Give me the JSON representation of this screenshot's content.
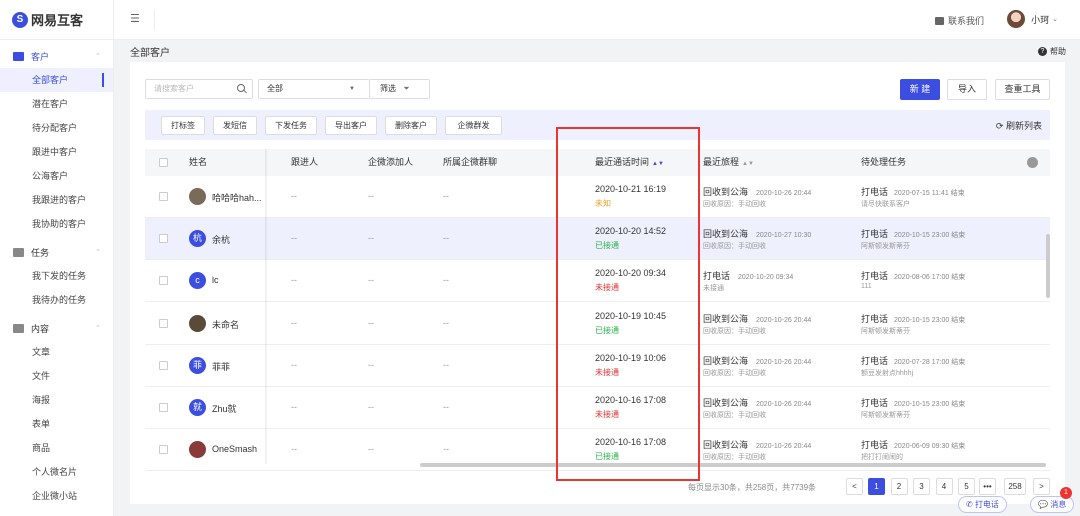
{
  "brand": {
    "name": "网易互客"
  },
  "colors": {
    "accent": "#3b4ee0",
    "red": "#e33333",
    "green": "#2bb34a",
    "orange": "#f0a020"
  },
  "sidebar": {
    "groups": [
      {
        "label": "客户",
        "icon": "contact-card-icon",
        "items": [
          "全部客户",
          "潜在客户",
          "待分配客户",
          "跟进中客户",
          "公海客户",
          "我跟进的客户",
          "我协助的客户"
        ]
      },
      {
        "label": "任务",
        "icon": "task-icon",
        "items": [
          "我下发的任务",
          "我待办的任务"
        ]
      },
      {
        "label": "内容",
        "icon": "content-icon",
        "items": [
          "文章",
          "文件",
          "海报",
          "表单",
          "商品",
          "个人微名片",
          "企业微小站"
        ]
      }
    ]
  },
  "topbar": {
    "contact": "联系我们",
    "user": "小珂"
  },
  "page": {
    "title": "全部客户",
    "help": "帮助"
  },
  "filters": {
    "search_placeholder": "请搜索客户",
    "select_value": "全部",
    "filter_label": "筛选",
    "new": "新 建",
    "import": "导入",
    "dedup": "查重工具"
  },
  "toolbar": {
    "buttons": [
      "打标签",
      "发短信",
      "下发任务",
      "导出客户",
      "删除客户",
      "企微群发"
    ],
    "refresh": "刷新列表"
  },
  "table": {
    "headers": [
      "姓名",
      "跟进人",
      "企微添加人",
      "所属企微群聊",
      "最近通话时间",
      "最近旅程",
      "待处理任务"
    ],
    "rows": [
      {
        "name": "哈哈哈hah...",
        "avatar_text": "",
        "avatar_color": "#7a6a5a",
        "follower": "--",
        "adder": "--",
        "group": "--",
        "call_time": "2020-10-21 16:19",
        "call_status": "未知",
        "status_color": "#f0a020",
        "journey": "回收到公海",
        "journey_time": "2020-10-26 20:44",
        "journey_sub": "回收原因：手动回收",
        "task": "打电话",
        "task_time": "2020-07-15 11:41 结束",
        "task_sub": "请尽快联系客户"
      },
      {
        "name": "余杭",
        "avatar_text": "杭",
        "avatar_color": "#3b4ee0",
        "follower": "--",
        "adder": "--",
        "group": "--",
        "call_time": "2020-10-20 14:52",
        "call_status": "已接通",
        "status_color": "#2bb34a",
        "journey": "回收到公海",
        "journey_time": "2020-10-27 10:30",
        "journey_sub": "回收原因：手动回收",
        "task": "打电话",
        "task_time": "2020-10-15 23:00 结束",
        "task_sub": "阿斯顿发斯蒂芬"
      },
      {
        "name": "lc",
        "avatar_text": "c",
        "avatar_color": "#3b4ee0",
        "follower": "--",
        "adder": "--",
        "group": "--",
        "call_time": "2020-10-20 09:34",
        "call_status": "未接通",
        "status_color": "#e33333",
        "journey": "打电话",
        "journey_time": "2020-10-20 09:34",
        "journey_sub": "未接通",
        "task": "打电话",
        "task_time": "2020-08-06 17:00 结束",
        "task_sub": "111"
      },
      {
        "name": "未命名",
        "avatar_text": "",
        "avatar_color": "#5a4a3a",
        "follower": "--",
        "adder": "--",
        "group": "--",
        "call_time": "2020-10-19 10:45",
        "call_status": "已接通",
        "status_color": "#2bb34a",
        "journey": "回收到公海",
        "journey_time": "2020-10-26 20:44",
        "journey_sub": "回收原因：手动回收",
        "task": "打电话",
        "task_time": "2020-10-15 23:00 结束",
        "task_sub": "阿斯顿发斯蒂芬"
      },
      {
        "name": "菲菲",
        "avatar_text": "菲",
        "avatar_color": "#3b4ee0",
        "follower": "--",
        "adder": "--",
        "group": "--",
        "call_time": "2020-10-19 10:06",
        "call_status": "未接通",
        "status_color": "#e33333",
        "journey": "回收到公海",
        "journey_time": "2020-10-26 20:44",
        "journey_sub": "回收原因：手动回收",
        "task": "打电话",
        "task_time": "2020-07-28 17:00 结束",
        "task_sub": "额豆发射点hhhhj"
      },
      {
        "name": "Zhu就",
        "avatar_text": "就",
        "avatar_color": "#3b4ee0",
        "follower": "--",
        "adder": "--",
        "group": "--",
        "call_time": "2020-10-16 17:08",
        "call_status": "未接通",
        "status_color": "#e33333",
        "journey": "回收到公海",
        "journey_time": "2020-10-26 20:44",
        "journey_sub": "回收原因：手动回收",
        "task": "打电话",
        "task_time": "2020-10-15 23:00 结束",
        "task_sub": "阿斯顿发斯蒂芬"
      },
      {
        "name": "OneSmash",
        "avatar_text": "",
        "avatar_color": "#8a3a3a",
        "follower": "--",
        "adder": "--",
        "group": "--",
        "call_time": "2020-10-16 17:08",
        "call_status": "已接通",
        "status_color": "#2bb34a",
        "journey": "回收到公海",
        "journey_time": "2020-10-26 20:44",
        "journey_sub": "回收原因：手动回收",
        "task": "打电话",
        "task_time": "2020-06-09 09:30 结束",
        "task_sub": "把打打闹闹的"
      }
    ]
  },
  "pagination": {
    "info": "每页显示30条，共258页，共7739条",
    "prev": "<",
    "pages": [
      "1",
      "2",
      "3",
      "4",
      "5"
    ],
    "ellipsis": "•••",
    "last": "258",
    "next": ">",
    "current": "1"
  },
  "float": {
    "call": "打电话",
    "message": "消息",
    "badge": "1"
  }
}
